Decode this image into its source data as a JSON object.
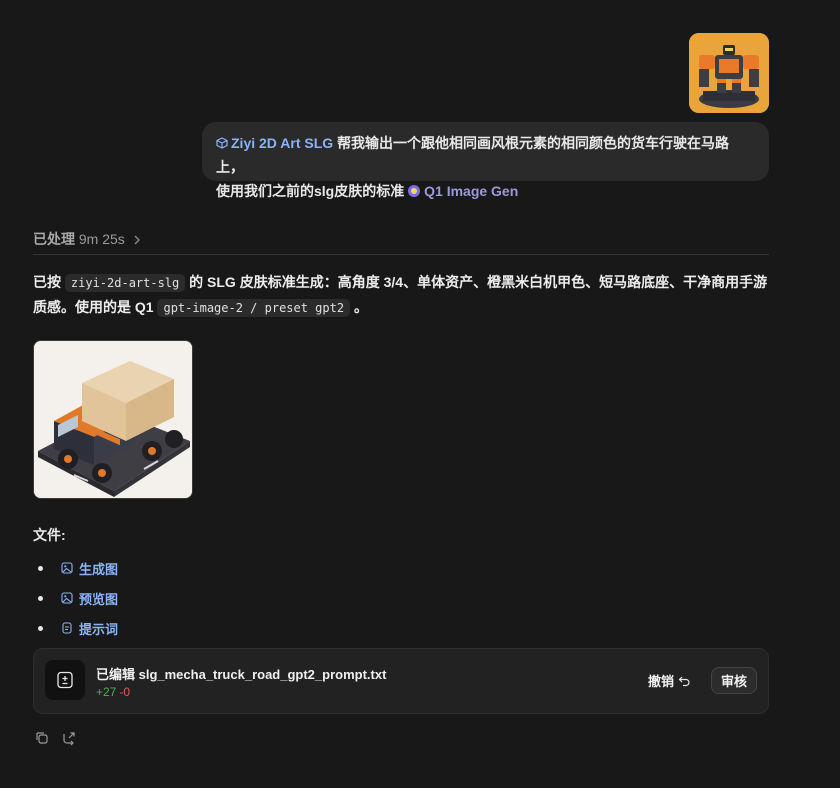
{
  "user_message": {
    "skill_label": "Ziyi 2D Art SLG",
    "text_line1": "帮我输出一个跟他相同画风根元素的相同颜色的货车行驶在马路上，",
    "text_line2": "使用我们之前的slg皮肤的标准",
    "gen_chip_label": "Q1 Image Gen",
    "attachment_icon": "mecha-robot-thumbnail"
  },
  "processed": {
    "label": "已处理",
    "duration": "9m 25s",
    "chevron_icon": "chevron-right-icon"
  },
  "response": {
    "p1_a": "已按",
    "p1_code": "ziyi-2d-art-slg",
    "p1_b": "的 SLG 皮肤标准生成：高角度 3/4、单体资产、橙黑米白机甲色、短马路底座、干净商用手游",
    "p2_a": "质感。使用的是 Q1",
    "p2_code": "gpt-image-2 / preset gpt2",
    "p2_b": "。"
  },
  "generated_image": {
    "icon": "truck-image"
  },
  "files": {
    "title": "文件:",
    "items": [
      {
        "label": "生成图",
        "icon": "image-file-icon"
      },
      {
        "label": "预览图",
        "icon": "image-file-icon"
      },
      {
        "label": "提示词",
        "icon": "text-file-icon"
      }
    ]
  },
  "edit_card": {
    "title": "已编辑 slg_mecha_truck_road_gpt2_prompt.txt",
    "additions": "+27",
    "deletions": "-0",
    "undo_label": "撤销",
    "review_label": "审核"
  },
  "colors": {
    "background": "#181818",
    "link": "#8ab4f8",
    "add": "#4caf50",
    "remove": "#e05a5a"
  }
}
